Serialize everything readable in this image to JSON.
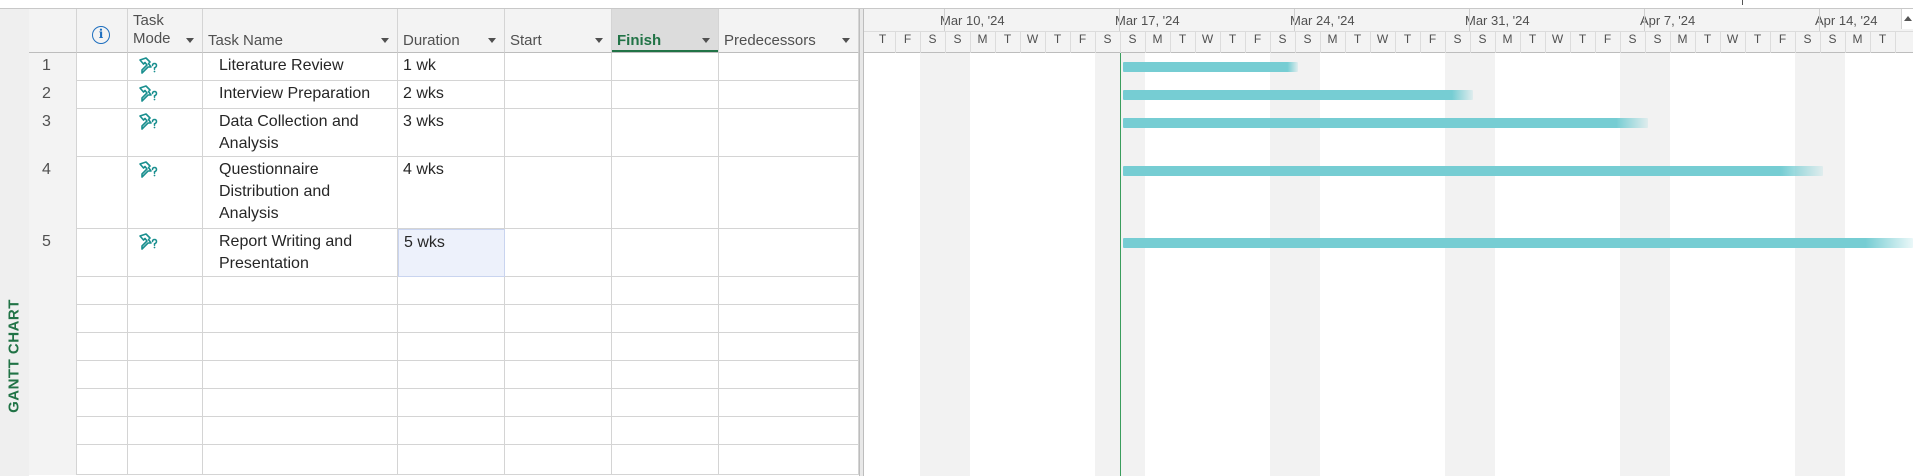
{
  "view_label": "GANTT CHART",
  "columns": {
    "info_icon": "info-icon",
    "task_mode": "Task\nMode",
    "task_name": "Task Name",
    "duration": "Duration",
    "start": "Start",
    "finish": "Finish",
    "predecessors": "Predecessors"
  },
  "tasks": [
    {
      "id": "1",
      "name": "Literature Review",
      "duration": "1 wk",
      "start": "",
      "finish": "",
      "predecessors": "",
      "mode_icon": "manually-scheduled-pin-icon",
      "duration_weeks": 1
    },
    {
      "id": "2",
      "name": "Interview Preparation",
      "duration": "2 wks",
      "start": "",
      "finish": "",
      "predecessors": "",
      "mode_icon": "manually-scheduled-pin-icon",
      "duration_weeks": 2
    },
    {
      "id": "3",
      "name": "Data Collection and Analysis",
      "duration": "3 wks",
      "start": "",
      "finish": "",
      "predecessors": "",
      "mode_icon": "manually-scheduled-pin-icon",
      "duration_weeks": 3
    },
    {
      "id": "4",
      "name": "Questionnaire Distribution and Analysis",
      "duration": "4 wks",
      "start": "",
      "finish": "",
      "predecessors": "",
      "mode_icon": "manually-scheduled-pin-icon",
      "duration_weeks": 4
    },
    {
      "id": "5",
      "name": "Report Writing and Presentation",
      "duration": "5 wks",
      "start": "",
      "finish": "",
      "predecessors": "",
      "mode_icon": "manually-scheduled-pin-icon",
      "duration_weeks": 5
    }
  ],
  "timescale": {
    "weeks": [
      "Mar 10, '24",
      "Mar 17, '24",
      "Mar 24, '24",
      "Mar 31, '24",
      "Apr 7, '24",
      "Apr 14, '24"
    ],
    "days": [
      "T",
      "F",
      "S",
      "S",
      "M",
      "T",
      "W",
      "T",
      "F",
      "S",
      "S",
      "M",
      "T",
      "W",
      "T",
      "F",
      "S",
      "S",
      "M",
      "T",
      "W",
      "T",
      "F",
      "S",
      "S",
      "M",
      "T",
      "W",
      "T",
      "F",
      "S",
      "S",
      "M",
      "T",
      "W",
      "T",
      "F",
      "S",
      "S",
      "M",
      "T"
    ]
  },
  "colors": {
    "bar": "#76cdd3",
    "view_label": "#217346",
    "pin_icon": "#1a8f8f"
  }
}
